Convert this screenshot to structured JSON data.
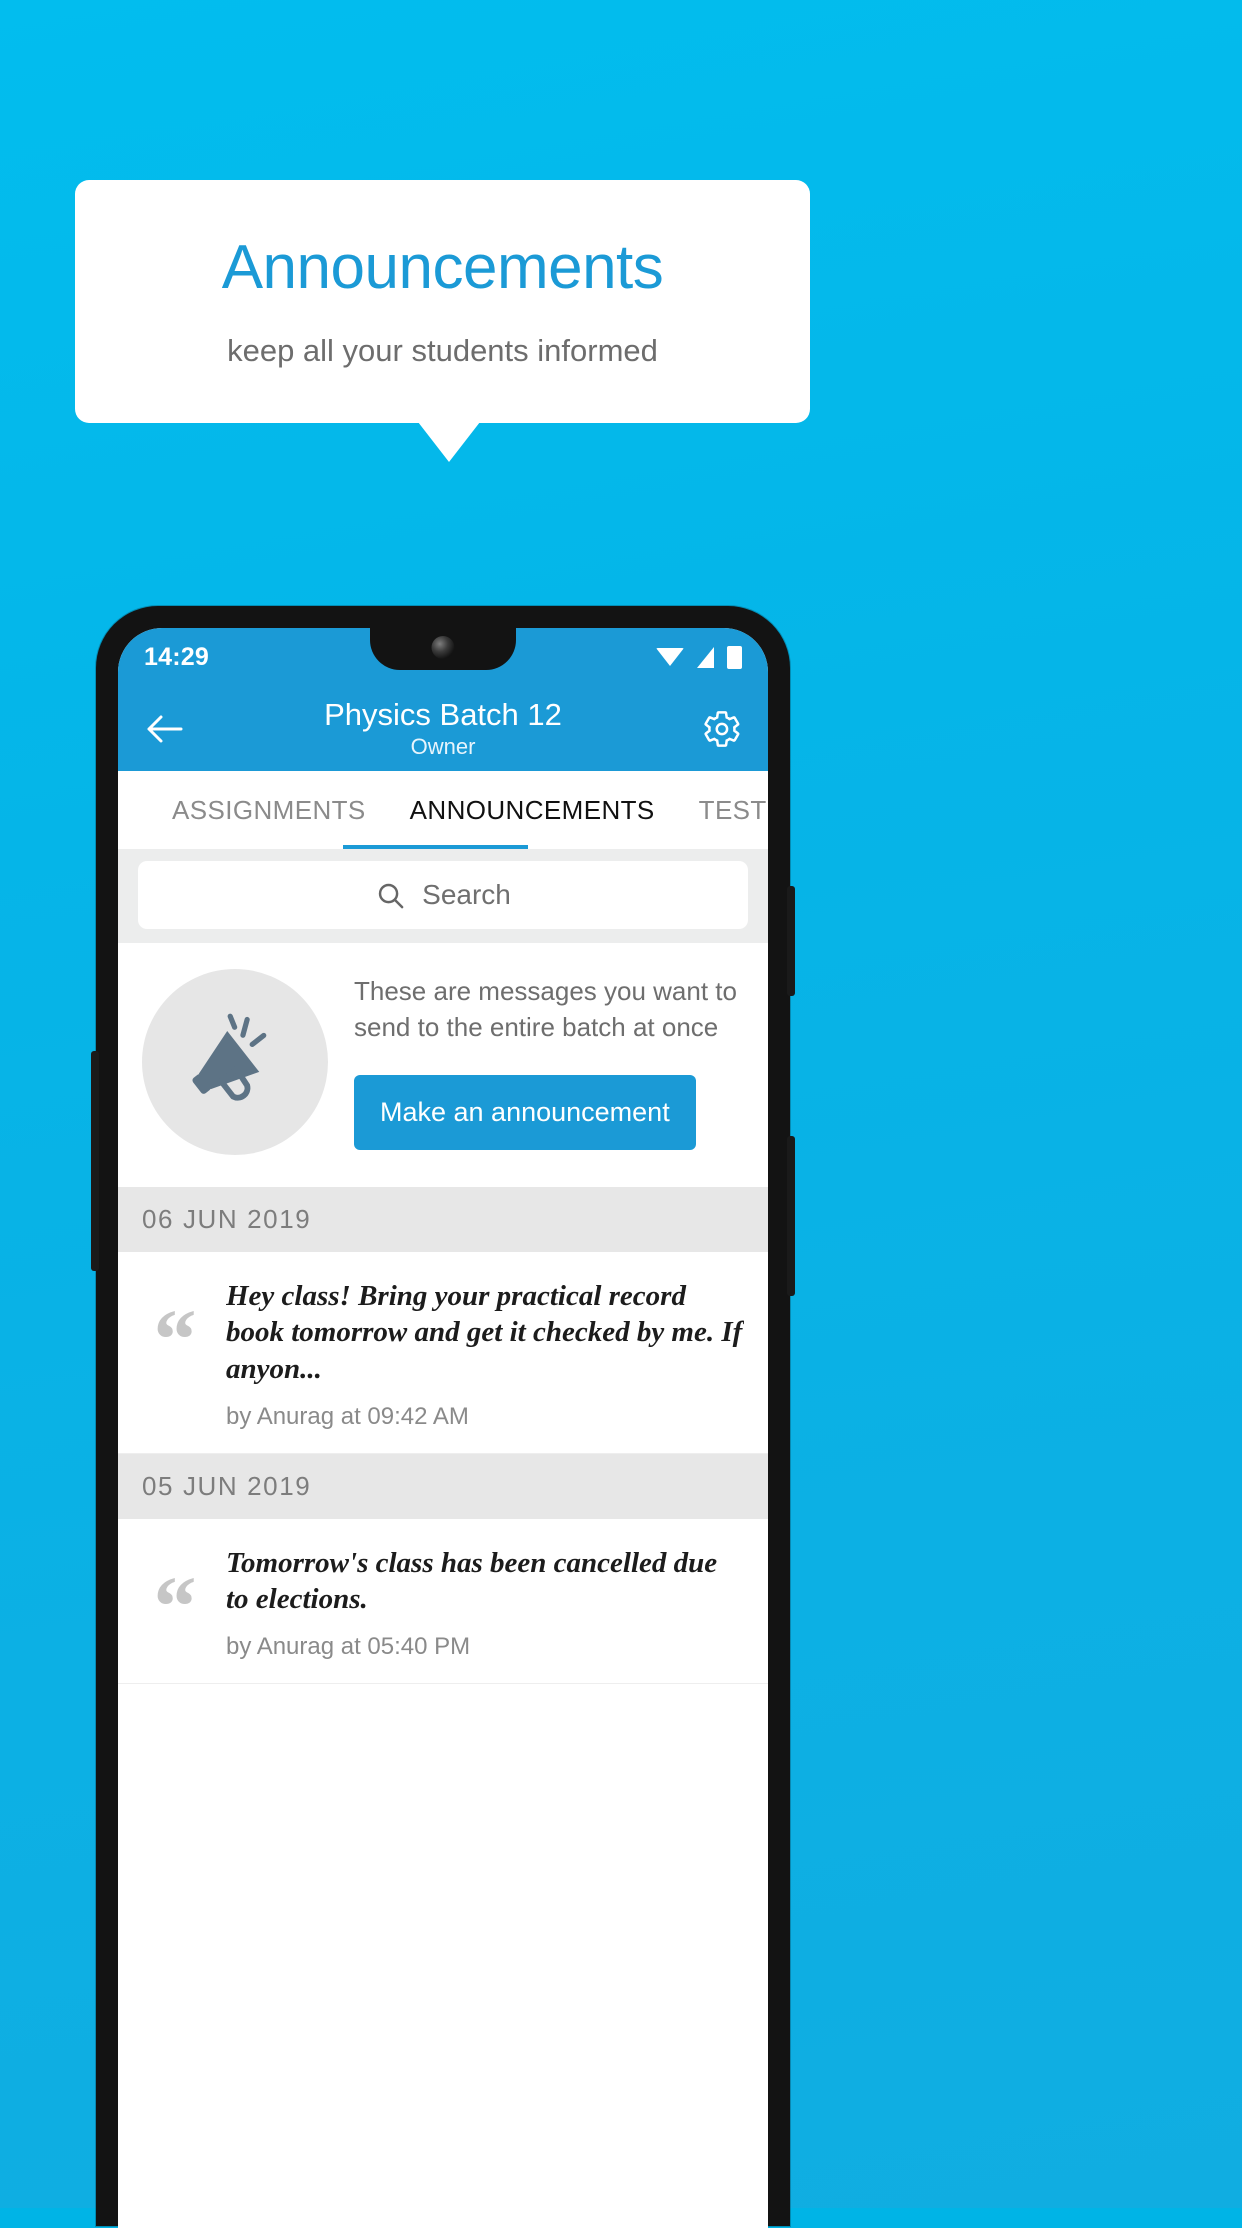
{
  "promo": {
    "title": "Announcements",
    "subtitle": "keep all your students informed"
  },
  "phone": {
    "status": {
      "time": "14:29",
      "icons": [
        "wifi-icon",
        "signal-icon",
        "battery-icon"
      ]
    },
    "appbar": {
      "back_icon": "back-arrow-icon",
      "title": "Physics Batch 12",
      "subtitle": "Owner",
      "settings_icon": "gear-icon"
    },
    "tabs": [
      {
        "label": "ASSIGNMENTS",
        "active": false
      },
      {
        "label": "ANNOUNCEMENTS",
        "active": true
      },
      {
        "label": "TESTS",
        "active": false
      },
      {
        "label": "’",
        "active": false
      }
    ],
    "search": {
      "icon": "search-icon",
      "placeholder": "Search",
      "value": ""
    },
    "empty_promo": {
      "icon": "megaphone-icon",
      "text": "These are messages you want to send to the entire batch at once",
      "button_label": "Make an announcement"
    },
    "groups": [
      {
        "date": "06  JUN  2019",
        "items": [
          {
            "quote_icon": "quote-icon",
            "text": "Hey class! Bring your practical record book tomorrow and get it checked by me. If anyon...",
            "meta": "by Anurag at 09:42 AM"
          }
        ]
      },
      {
        "date": "05  JUN  2019",
        "items": [
          {
            "quote_icon": "quote-icon",
            "text": "Tomorrow's class has been cancelled due to elections.",
            "meta": "by Anurag at 05:40 PM"
          }
        ]
      }
    ]
  },
  "colors": {
    "background": "#05b5e8",
    "accent": "#1b9ad6",
    "title": "#1b9ad6",
    "card": "#ffffff"
  }
}
